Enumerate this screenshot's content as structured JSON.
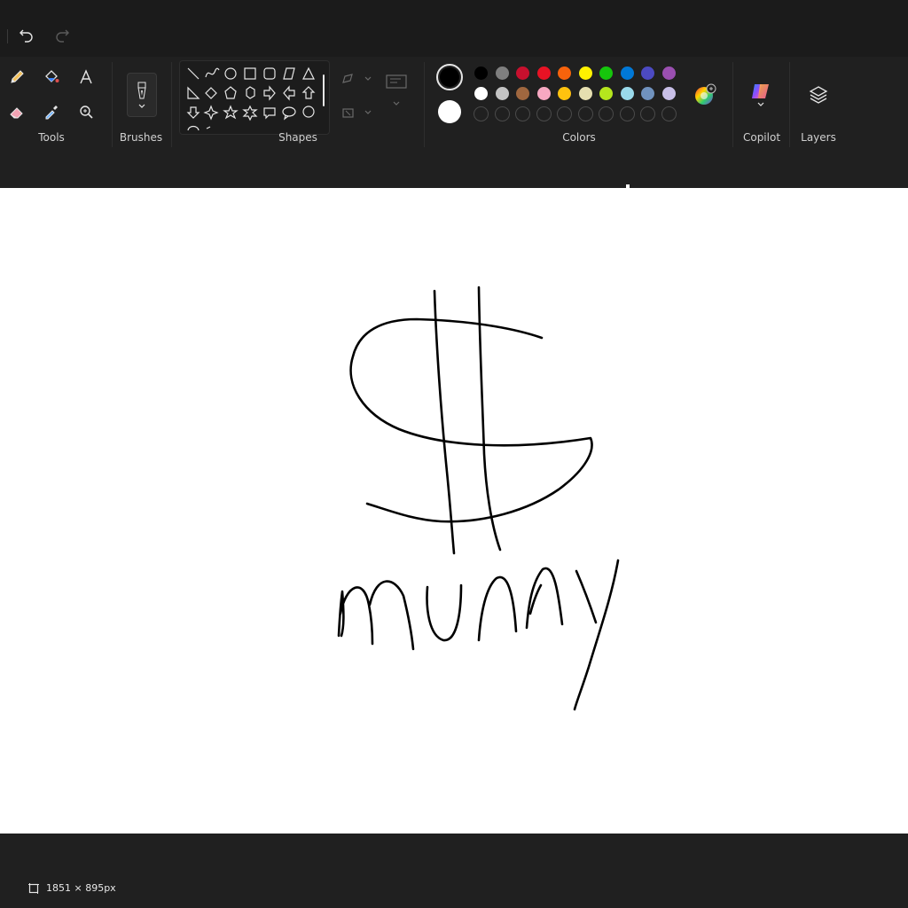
{
  "toolbar": {
    "undo_icon": "undo-icon",
    "redo_icon": "redo-icon"
  },
  "groups": {
    "tools": "Tools",
    "brushes": "Brushes",
    "shapes": "Shapes",
    "colors": "Colors",
    "copilot": "Copilot",
    "layers": "Layers"
  },
  "colors": {
    "primary": "#000000",
    "secondary": "#ffffff",
    "row1": [
      "#000000",
      "#7f7f7f",
      "#c8102e",
      "#e81224",
      "#f7630c",
      "#fff100",
      "#16c60c",
      "#0078d7",
      "#4c4ac2",
      "#9a4fb0"
    ],
    "row2": [
      "#ffffff",
      "#c3c3c3",
      "#a0673f",
      "#f7a8c2",
      "#ffc20e",
      "#e6dfb0",
      "#b5e61d",
      "#99d9ea",
      "#7092be",
      "#c8bfe7"
    ]
  },
  "status": {
    "canvas_size": "1851 × 895px"
  },
  "drawing": {
    "word": "munny"
  }
}
